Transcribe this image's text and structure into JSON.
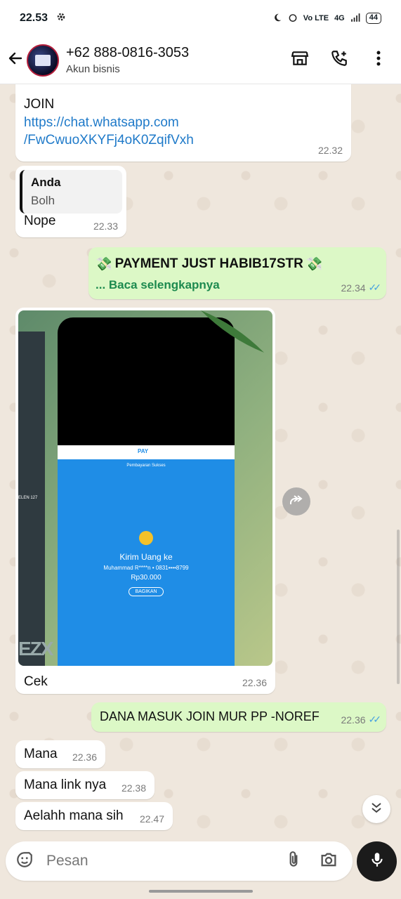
{
  "status_bar": {
    "time": "22.53",
    "battery": "44",
    "network": "4G",
    "volte": "Vo LTE"
  },
  "header": {
    "contact_name": "+62 888-0816-3053",
    "subtitle": "Akun bisnis"
  },
  "messages": [
    {
      "id": "m1",
      "direction": "in",
      "line1": "JOIN",
      "link": "https://chat.whatsapp.com/FwCwuoXKYFj4oK0ZqifVxh",
      "link_line1": "https://chat.whatsapp.com",
      "link_line2": "/FwCwuoXKYFj4oK0ZqifVxh",
      "time": "22.32"
    },
    {
      "id": "m2",
      "direction": "in",
      "quote_author": "Anda",
      "quote_text": "Bolh",
      "text": "Nope",
      "time": "22.33"
    },
    {
      "id": "m3",
      "direction": "out",
      "emoji": "💸",
      "text": "PAYMENT JUST HABIB17STR",
      "read_more": "... Baca selengkapnya",
      "time": "22.34"
    },
    {
      "id": "m4",
      "direction": "in",
      "caption": "Cek",
      "time": "22.36",
      "image": {
        "app_name": "PAY",
        "status": "Pembayaran Sukses",
        "title": "Kirim Uang ke",
        "recipient": "Muhammad R****n • 0831••••8799",
        "amount": "Rp30.000",
        "share": "BAGIKAN",
        "side_text": "ELEN 127",
        "side_letters": "EZX"
      }
    },
    {
      "id": "m5",
      "direction": "out",
      "text": "DANA MASUK JOIN MUR PP -NOREF",
      "time": "22.36"
    },
    {
      "id": "m6",
      "direction": "in",
      "text": "Mana",
      "time": "22.36"
    },
    {
      "id": "m7",
      "direction": "in",
      "text": "Mana link nya",
      "time": "22.38"
    },
    {
      "id": "m8",
      "direction": "in",
      "text": "Aelahh mana sih",
      "time": "22.47"
    }
  ],
  "composer": {
    "placeholder": "Pesan"
  },
  "icons": [
    "settings-icon",
    "back-arrow-icon",
    "store-icon",
    "add-call-icon",
    "more-vert-icon",
    "forward-icon",
    "scroll-down-icon",
    "emoji-sticker-icon",
    "attach-icon",
    "camera-icon",
    "mic-icon"
  ],
  "colors": {
    "outgoing_bubble": "#dcf8c6",
    "incoming_bubble": "#ffffff",
    "link": "#1f7ac9",
    "read_more": "#1d8a4f",
    "read_ticks": "#4aa3df",
    "chat_bg": "#efe7dd"
  }
}
